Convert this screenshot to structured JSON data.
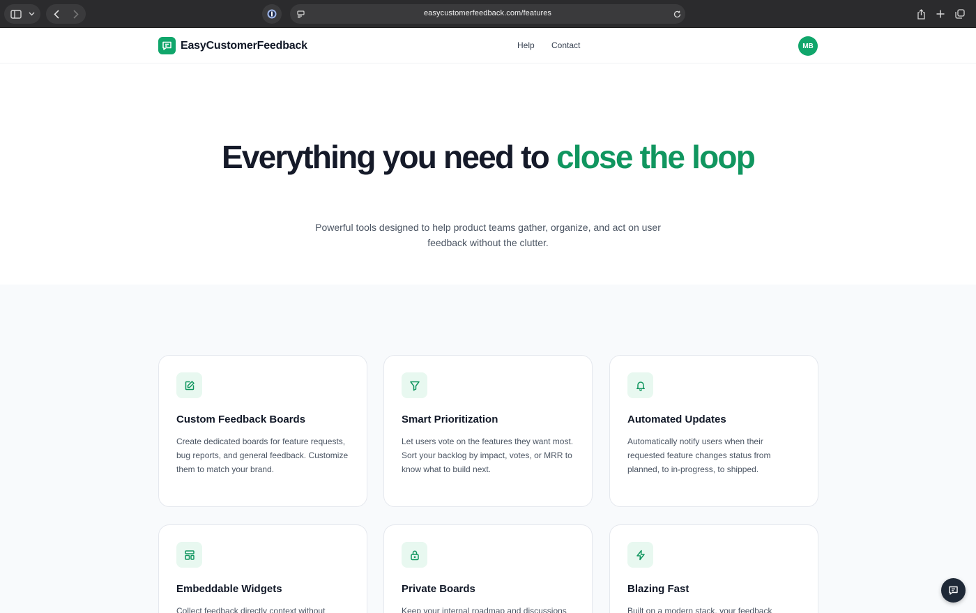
{
  "browser": {
    "url": "easycustomerfeedback.com/features"
  },
  "header": {
    "brand": "EasyCustomerFeedback",
    "nav": [
      {
        "label": "Help"
      },
      {
        "label": "Contact"
      }
    ],
    "avatar_initials": "MB"
  },
  "hero": {
    "title_part1": "Everything you need to ",
    "title_accent": "close the loop",
    "subtitle": "Powerful tools designed to help product teams gather, organize, and act on user feedback without the clutter."
  },
  "features": [
    {
      "icon": "edit-icon",
      "title": "Custom Feedback Boards",
      "description": "Create dedicated boards for feature requests, bug reports, and general feedback. Customize them to match your brand."
    },
    {
      "icon": "filter-icon",
      "title": "Smart Prioritization",
      "description": "Let users vote on the features they want most. Sort your backlog by impact, votes, or MRR to know what to build next."
    },
    {
      "icon": "bell-icon",
      "title": "Automated Updates",
      "description": "Automatically notify users when their requested feature changes status from planned, to in-progress, to shipped."
    },
    {
      "icon": "layout-icon",
      "title": "Embeddable Widgets",
      "description": "Collect feedback directly context without"
    },
    {
      "icon": "lock-icon",
      "title": "Private Boards",
      "description": "Keep your internal roadmap and discussions"
    },
    {
      "icon": "lightning-icon",
      "title": "Blazing Fast",
      "description": "Built on a modern stack, your feedback"
    }
  ],
  "colors": {
    "brand": "#10a66b",
    "accent_text": "#10965f",
    "icon_bg": "#e8f8f0"
  }
}
